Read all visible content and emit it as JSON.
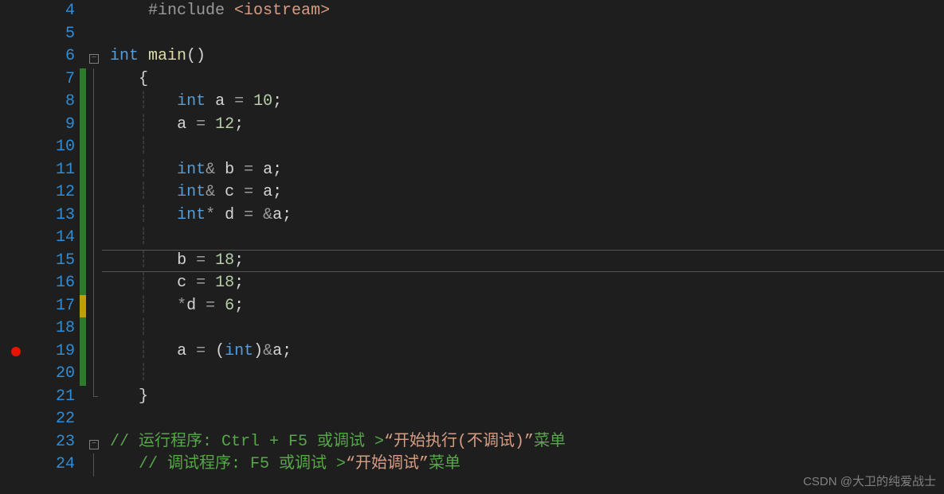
{
  "watermark": "CSDN @大卫的纯爱战士",
  "lines": [
    {
      "n": 4,
      "bp": false,
      "mark": "",
      "fold": "",
      "tokens": [
        [
          "indent-guide",
          "    "
        ],
        [
          "t-pre",
          "#include "
        ],
        [
          "t-angle",
          "<iostream>"
        ]
      ]
    },
    {
      "n": 5,
      "bp": false,
      "mark": "",
      "fold": "",
      "tokens": []
    },
    {
      "n": 6,
      "bp": false,
      "mark": "",
      "fold": "minus",
      "tokens": [
        [
          "t-kw",
          "int "
        ],
        [
          "t-fn",
          "main"
        ],
        [
          "t-pl",
          "()"
        ]
      ]
    },
    {
      "n": 7,
      "bp": false,
      "mark": "green",
      "fold": "bar",
      "tokens": [
        [
          "indent-guide",
          "   "
        ],
        [
          "t-pl",
          "{"
        ]
      ]
    },
    {
      "n": 8,
      "bp": false,
      "mark": "green",
      "fold": "bar",
      "tokens": [
        [
          "indent-guide",
          "   ┊   "
        ],
        [
          "t-kw",
          "int"
        ],
        [
          "t-pl",
          " a "
        ],
        [
          "t-op",
          "= "
        ],
        [
          "t-num",
          "10"
        ],
        [
          "t-pl",
          ";"
        ]
      ]
    },
    {
      "n": 9,
      "bp": false,
      "mark": "green",
      "fold": "bar",
      "tokens": [
        [
          "indent-guide",
          "   ┊   "
        ],
        [
          "t-pl",
          "a "
        ],
        [
          "t-op",
          "= "
        ],
        [
          "t-num",
          "12"
        ],
        [
          "t-pl",
          ";"
        ]
      ]
    },
    {
      "n": 10,
      "bp": false,
      "mark": "green",
      "fold": "bar",
      "tokens": [
        [
          "indent-guide",
          "   ┊"
        ]
      ]
    },
    {
      "n": 11,
      "bp": false,
      "mark": "green",
      "fold": "bar",
      "tokens": [
        [
          "indent-guide",
          "   ┊   "
        ],
        [
          "t-kw",
          "int"
        ],
        [
          "t-op",
          "&"
        ],
        [
          "t-pl",
          " b "
        ],
        [
          "t-op",
          "= "
        ],
        [
          "t-pl",
          "a;"
        ]
      ]
    },
    {
      "n": 12,
      "bp": false,
      "mark": "green",
      "fold": "bar",
      "tokens": [
        [
          "indent-guide",
          "   ┊   "
        ],
        [
          "t-kw",
          "int"
        ],
        [
          "t-op",
          "&"
        ],
        [
          "t-pl",
          " c "
        ],
        [
          "t-op",
          "= "
        ],
        [
          "t-pl",
          "a;"
        ]
      ]
    },
    {
      "n": 13,
      "bp": false,
      "mark": "green",
      "fold": "bar",
      "tokens": [
        [
          "indent-guide",
          "   ┊   "
        ],
        [
          "t-kw",
          "int"
        ],
        [
          "t-op",
          "*"
        ],
        [
          "t-pl",
          " d "
        ],
        [
          "t-op",
          "= &"
        ],
        [
          "t-pl",
          "a;"
        ]
      ]
    },
    {
      "n": 14,
      "bp": false,
      "mark": "green",
      "fold": "bar",
      "tokens": [
        [
          "indent-guide",
          "   ┊"
        ]
      ]
    },
    {
      "n": 15,
      "bp": false,
      "mark": "green",
      "fold": "bar",
      "tokens": [
        [
          "indent-guide",
          "   ┊   "
        ],
        [
          "t-pl",
          "b "
        ],
        [
          "t-op",
          "= "
        ],
        [
          "t-num",
          "18"
        ],
        [
          "t-pl",
          ";"
        ]
      ],
      "current": true
    },
    {
      "n": 16,
      "bp": false,
      "mark": "green",
      "fold": "bar",
      "tokens": [
        [
          "indent-guide",
          "   ┊   "
        ],
        [
          "t-pl",
          "c "
        ],
        [
          "t-op",
          "= "
        ],
        [
          "t-num",
          "18"
        ],
        [
          "t-pl",
          ";"
        ]
      ]
    },
    {
      "n": 17,
      "bp": false,
      "mark": "yellow",
      "fold": "bar",
      "tokens": [
        [
          "indent-guide",
          "   ┊   "
        ],
        [
          "t-op",
          "*"
        ],
        [
          "t-pl",
          "d "
        ],
        [
          "t-op",
          "= "
        ],
        [
          "t-num",
          "6"
        ],
        [
          "t-pl",
          ";"
        ]
      ]
    },
    {
      "n": 18,
      "bp": false,
      "mark": "green",
      "fold": "bar",
      "tokens": [
        [
          "indent-guide",
          "   ┊"
        ]
      ]
    },
    {
      "n": 19,
      "bp": true,
      "mark": "green",
      "fold": "bar",
      "tokens": [
        [
          "indent-guide",
          "   ┊   "
        ],
        [
          "t-pl",
          "a "
        ],
        [
          "t-op",
          "= "
        ],
        [
          "t-pl",
          "("
        ],
        [
          "t-kw",
          "int"
        ],
        [
          "t-pl",
          ")"
        ],
        [
          "t-op",
          "&"
        ],
        [
          "t-pl",
          "a;"
        ]
      ]
    },
    {
      "n": 20,
      "bp": false,
      "mark": "green",
      "fold": "bar",
      "tokens": [
        [
          "indent-guide",
          "   ┊"
        ]
      ]
    },
    {
      "n": 21,
      "bp": false,
      "mark": "",
      "fold": "end",
      "tokens": [
        [
          "indent-guide",
          "   "
        ],
        [
          "t-pl",
          "}"
        ]
      ]
    },
    {
      "n": 22,
      "bp": false,
      "mark": "",
      "fold": "",
      "tokens": []
    },
    {
      "n": 23,
      "bp": false,
      "mark": "",
      "fold": "minus",
      "tokens": [
        [
          "t-cmt",
          "// 运行程序: Ctrl + F5 或调试 >"
        ],
        [
          "t-str",
          "“开始执行(不调试)”"
        ],
        [
          "t-cmt",
          "菜单"
        ]
      ]
    },
    {
      "n": 24,
      "bp": false,
      "mark": "",
      "fold": "bar",
      "tokens": [
        [
          "indent-guide",
          "   "
        ],
        [
          "t-cmt",
          "// 调试程序: F5 或调试 >"
        ],
        [
          "t-str",
          "“开始调试”"
        ],
        [
          "t-cmt",
          "菜单"
        ]
      ]
    }
  ]
}
